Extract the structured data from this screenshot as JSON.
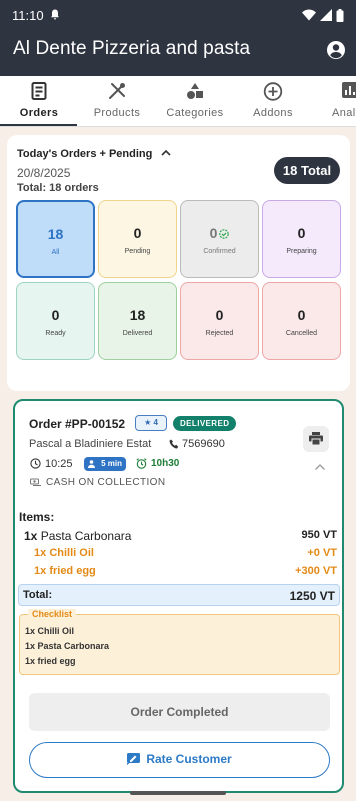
{
  "status_bar": {
    "time": "11:10"
  },
  "app": {
    "title": "Al Dente Pizzeria and pasta"
  },
  "tabs": [
    {
      "label": "Orders",
      "icon": "receipt-icon",
      "active": true
    },
    {
      "label": "Products",
      "icon": "utensils-icon",
      "active": false
    },
    {
      "label": "Categories",
      "icon": "shapes-icon",
      "active": false
    },
    {
      "label": "Addons",
      "icon": "plus-circle-icon",
      "active": false
    },
    {
      "label": "Analy",
      "icon": "chart-icon",
      "active": false
    }
  ],
  "summary": {
    "title": "Today's Orders + Pending",
    "date": "20/8/2025",
    "total_text": "Total: 18 orders",
    "total_pill": "18 Total",
    "stats": [
      {
        "count": "18",
        "label": "All",
        "color": "#2e73c4"
      },
      {
        "count": "0",
        "label": "Pending",
        "color": "#f0d48a"
      },
      {
        "count": "0",
        "label": "Confirmed",
        "color": "#bbbbbb"
      },
      {
        "count": "0",
        "label": "Preparing",
        "color": "#c9a9e6"
      },
      {
        "count": "0",
        "label": "Ready",
        "color": "#9fd3c3"
      },
      {
        "count": "18",
        "label": "Delivered",
        "color": "#9fcf9f"
      },
      {
        "count": "0",
        "label": "Rejected",
        "color": "#eea6a6"
      },
      {
        "count": "0",
        "label": "Cancelled",
        "color": "#eea6a6"
      }
    ]
  },
  "order": {
    "number": "Order #PP-00152",
    "rating": "4",
    "status": "DELIVERED",
    "customer": "Pascal a Bladiniere Estat",
    "phone": "7569690",
    "time": "10:25",
    "eta": "5 min",
    "ready_time": "10h30",
    "payment": "CASH ON COLLECTION",
    "items_heading": "Items:",
    "items": [
      {
        "qty": "1x",
        "name": "Pasta Carbonara",
        "price": "950 VT",
        "addon": false
      },
      {
        "qty": "1x",
        "name": "Chilli Oil",
        "price": "+0 VT",
        "addon": true
      },
      {
        "qty": "1x",
        "name": "fried egg",
        "price": "+300 VT",
        "addon": true
      }
    ],
    "total_label": "Total:",
    "total_value": "1250 VT",
    "checklist_title": "Checklist",
    "checklist": [
      "1x Chilli Oil",
      "1x Pasta Carbonara",
      "1x fried egg"
    ],
    "completed_label": "Order Completed",
    "rate_label": "Rate Customer"
  }
}
